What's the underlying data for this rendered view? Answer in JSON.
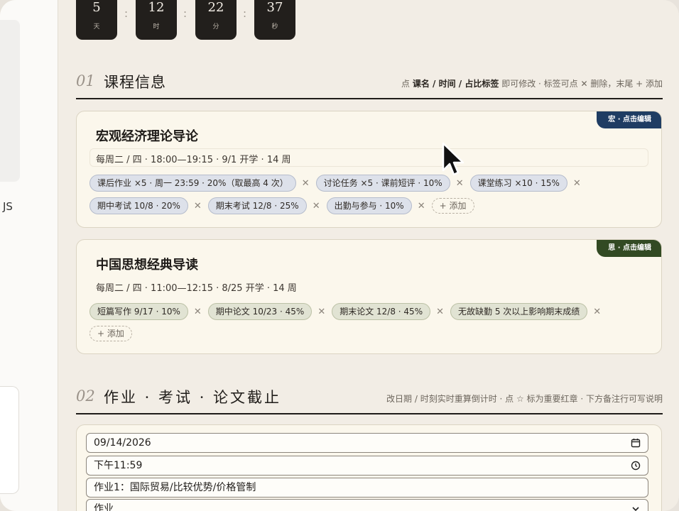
{
  "sidebar": {
    "label": "JS"
  },
  "countdown": [
    {
      "value": "5",
      "unit": "天"
    },
    {
      "value": "12",
      "unit": "时"
    },
    {
      "value": "22",
      "unit": "分"
    },
    {
      "value": "37",
      "unit": "秒"
    }
  ],
  "countdown_sep": ":",
  "section1": {
    "num": "01",
    "title": "课程信息",
    "hint_pre": "点",
    "hint_bold": "课名 / 时间 / 占比标签",
    "hint_post": "即可修改 · 标签可点 ✕ 删除，末尾 + 添加"
  },
  "courses": [
    {
      "tag": "宏 · 点击编辑",
      "name": "宏观经济理论导论",
      "schedule": "每周二 / 四 · 18:00—19:15 · 9/1 开学 · 14 周",
      "row1": [
        "课后作业 ×5 · 周一 23:59 · 20%（取最高 4 次）",
        "讨论任务 ×5 · 课前短评 · 10%",
        "课堂练习 ×10 · 15%"
      ],
      "row2": [
        "期中考试 10/8 · 20%",
        "期末考试 12/8 · 25%",
        "出勤与参与 · 10%"
      ],
      "add": "+ 添加",
      "remove": "✕"
    },
    {
      "tag": "思 · 点击编辑",
      "name": "中国思想经典导读",
      "schedule": "每周二 / 四 · 11:00—12:15 · 8/25 开学 · 14 周",
      "row1": [
        "短篇写作 9/17 · 10%",
        "期中论文 10/23 · 45%",
        "期末论文 12/8 · 45%",
        "无故缺勤 5 次以上影响期末成绩"
      ],
      "add": "+ 添加",
      "remove": "✕"
    }
  ],
  "section2": {
    "num": "02",
    "title": "作业 · 考试 · 论文截止",
    "hint": "改日期 / 时刻实时重算倒计时 · 点 ☆ 标为重要红章 · 下方备注行可写说明"
  },
  "deadline_form": {
    "date": "09/14/2026",
    "time": "下午11:59",
    "title": "作业1：国际贸易/比较优势/价格管制",
    "type": "作业"
  },
  "colors": {
    "course1_tag": "#1f3d63",
    "course2_tag": "#324a23",
    "page_bg": "#f2ede5",
    "card_bg": "#fbf7ec"
  },
  "icons": [
    "calendar-icon",
    "clock-icon",
    "chevron-down-icon",
    "mouse-pointer-icon"
  ]
}
